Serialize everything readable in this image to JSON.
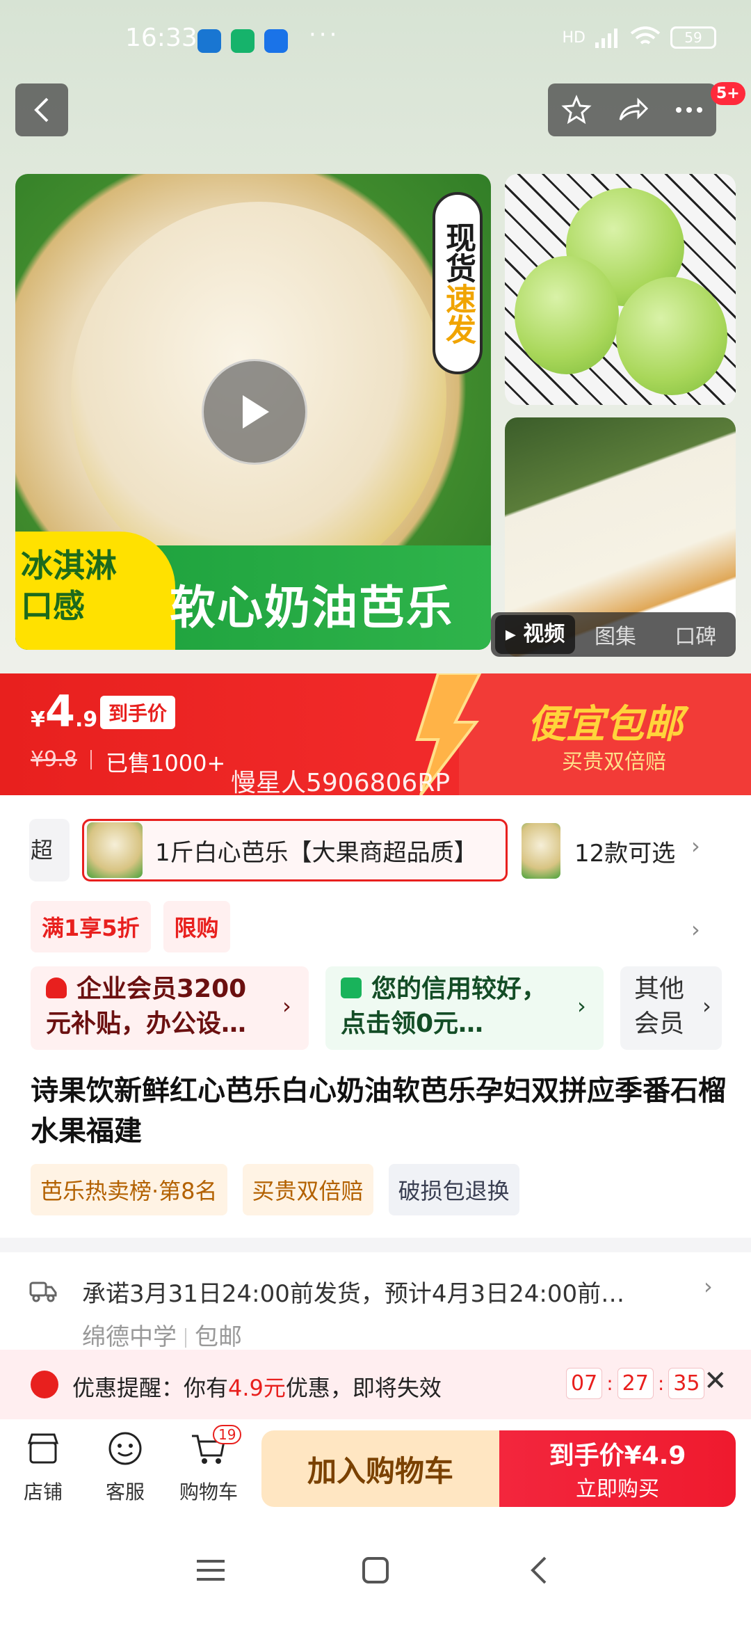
{
  "status_bar": {
    "time": "16:33",
    "battery": "59",
    "more": "···",
    "network": "HD"
  },
  "header": {
    "cart_badge": "5+"
  },
  "hero": {
    "vertical_tag_1": "现货",
    "vertical_tag_2": "速发",
    "corner_label": "冰淇淋\n口感",
    "band_text": "软心奶油芭乐",
    "media_tabs": [
      "视频",
      "图集",
      "口碑"
    ]
  },
  "price": {
    "currency": "¥",
    "integer": "4",
    "decimal": ".9",
    "tag": "到手价",
    "original": "¥9.8",
    "sold": "已售1000+",
    "watermark": "慢星人5906806RP",
    "slogan": "便宜包邮",
    "subslogan": "买贵双倍赔"
  },
  "sku": {
    "prev_label": "超",
    "selected": "1斤白心芭乐【大果商超品质】",
    "more": "12款可选"
  },
  "promos": [
    "满1享5折",
    "限购"
  ],
  "members": {
    "m1": "企业会员3200元补贴，办公设…",
    "m2": "您的信用较好，点击领0元…",
    "m3": "其他会员"
  },
  "title": "诗果饮新鲜红心芭乐白心奶油软芭乐孕妇双拼应季番石榴水果福建",
  "tags": [
    "芭乐热卖榜·第8名",
    "买贵双倍赔",
    "破损包退换"
  ],
  "shipping": {
    "text": "承诺3月31日24:00前发货，预计4月3日24:00前…",
    "location": "绵德中学",
    "free": "包邮"
  },
  "reminder": {
    "prefix": "优惠提醒：你有",
    "amount": "4.9元",
    "suffix": "优惠，即将失效",
    "hh": "07",
    "mm": "27",
    "ss": "35"
  },
  "bottom_bar": {
    "shop": "店铺",
    "service": "客服",
    "cart": "购物车",
    "cart_count": "19",
    "add_cart": "加入购物车",
    "buy_line1": "到手价¥4.9",
    "buy_line2": "立即购买"
  },
  "colors": {
    "accent": "#e8201e",
    "green": "#2fb44b",
    "slogan": "#ffd43b"
  }
}
